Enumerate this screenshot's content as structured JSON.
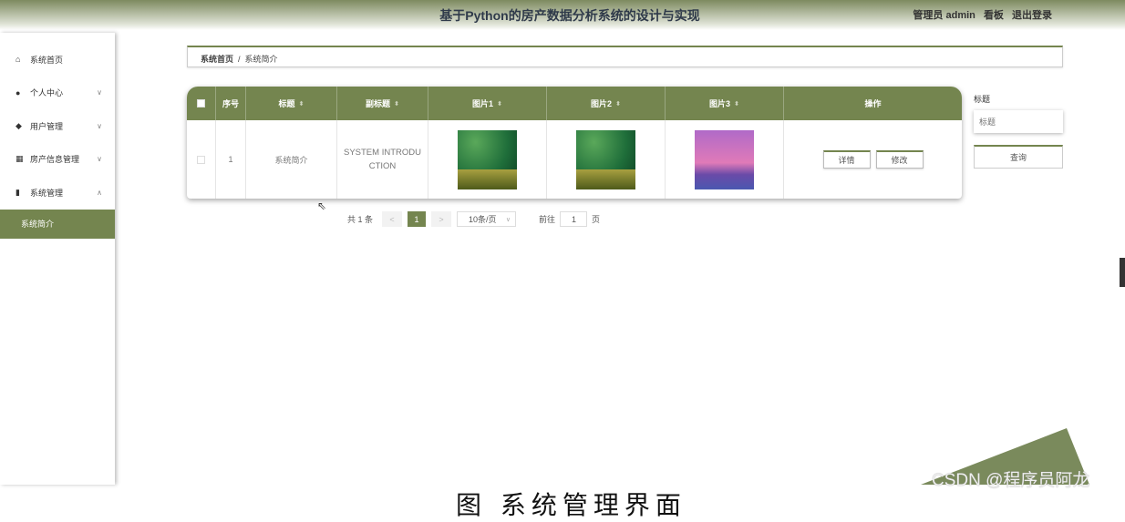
{
  "header": {
    "title": "基于Python的房产数据分析系统的设计与实现",
    "user": "管理员 admin",
    "dashboard": "看板",
    "logout": "退出登录"
  },
  "sidebar": {
    "items": [
      {
        "label": "系统首页",
        "icon": "home-icon"
      },
      {
        "label": "个人中心",
        "icon": "user-icon"
      },
      {
        "label": "用户管理",
        "icon": "pin-icon"
      },
      {
        "label": "房产信息管理",
        "icon": "grid-icon"
      },
      {
        "label": "系统管理",
        "icon": "bar-chart-icon"
      }
    ],
    "sub_active": "系统简介"
  },
  "breadcrumb": {
    "home": "系统首页",
    "sep": "/",
    "current": "系统简介"
  },
  "table": {
    "headers": [
      "序号",
      "标题",
      "副标题",
      "图片1",
      "图片2",
      "图片3",
      "操作"
    ],
    "rows": [
      {
        "index": "1",
        "title": "系统简介",
        "subtitle": "SYSTEM INTRODUCTION"
      }
    ],
    "detail_label": "详情",
    "edit_label": "修改"
  },
  "pager": {
    "total": "共 1 条",
    "prev": "<",
    "current": "1",
    "next": ">",
    "size": "10条/页",
    "goto": "前往",
    "page_value": "1",
    "page_unit": "页"
  },
  "search": {
    "label": "标题",
    "placeholder": "标题",
    "button": "查询"
  },
  "watermark": "CSDN @程序员阿龙",
  "caption": "图    系统管理界面",
  "colors": {
    "accent": "#74854f"
  }
}
